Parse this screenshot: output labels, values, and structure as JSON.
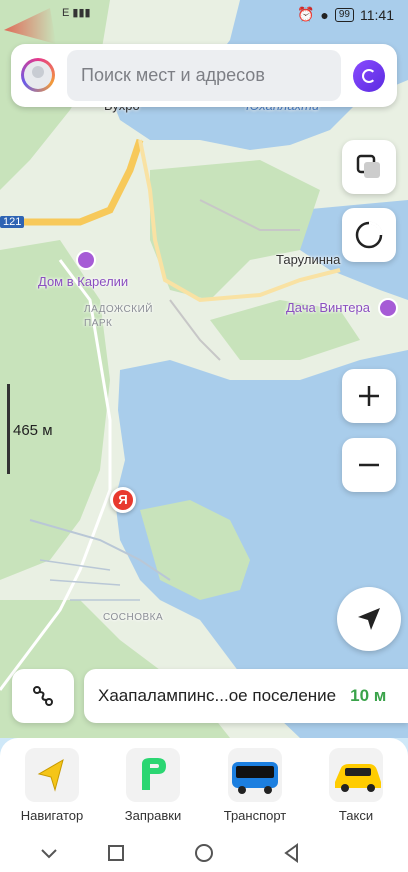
{
  "status_bar": {
    "signal_text": "E",
    "battery": "99",
    "time": "11:41"
  },
  "search": {
    "placeholder": "Поиск мест и адресов"
  },
  "map": {
    "labels": {
      "top_partial": "Бухро",
      "water_top": "Юханлахти",
      "road_number": "121",
      "tarulinna": "Тарулинна",
      "dom_v_karelii": "Дом в Карелии",
      "ladozhsky_park": "ЛАДОЖСКИЙ ПАРК",
      "dacha_vintera": "Дача Винтера",
      "sosnovka": "СОСНОВКА"
    },
    "scale": "465 м",
    "user_marker_letter": "Я"
  },
  "location_bar": {
    "address": "Хаапалампинс...ое поселение",
    "distance": "10 м"
  },
  "services": [
    {
      "label": "Навигатор",
      "icon": "navigator-icon"
    },
    {
      "label": "Заправки",
      "icon": "fuel-icon"
    },
    {
      "label": "Транспорт",
      "icon": "bus-icon"
    },
    {
      "label": "Такси",
      "icon": "taxi-icon"
    }
  ],
  "colors": {
    "land": "#e9f0e3",
    "forest": "#c8e3bb",
    "water": "#a9cdeb",
    "road_main": "#f7c95a",
    "accent_green": "#3aa34a",
    "marker_red": "#e8392e"
  }
}
